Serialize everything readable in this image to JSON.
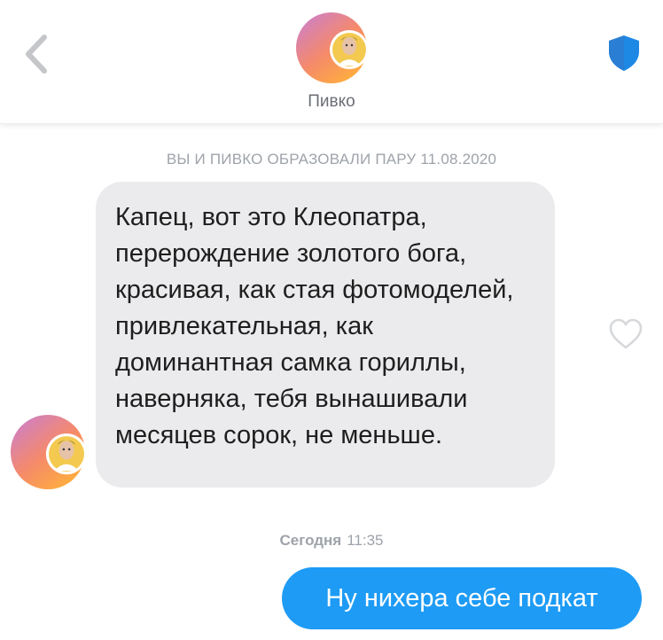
{
  "header": {
    "back_icon": "chevron-left-icon",
    "name": "Пивко",
    "safety_icon": "shield-icon",
    "colors": {
      "shield": "#1e88e5",
      "avatar_gradient_start": "#c77dd6",
      "avatar_gradient_end": "#ff9a2e"
    }
  },
  "conversation": {
    "match_notice": "ВЫ И ПИВКО ОБРАЗОВАЛИ ПАРУ 11.08.2020",
    "incoming_message": {
      "text": "Капец, вот это Клеопатра, перерождение золотого бога, красивая, как стая фотомоделей, привлекательная, как доминантная самка гориллы, наверняка, тебя вынашивали месяцев сорок, не меньше.",
      "like_icon": "heart-outline-icon"
    },
    "timestamp": {
      "day": "Сегодня",
      "time": "11:35"
    },
    "outgoing_message": {
      "text": "Ну нихера себе подкат"
    },
    "colors": {
      "incoming_bubble": "#ebebed",
      "outgoing_bubble": "#1e9bf5"
    }
  }
}
